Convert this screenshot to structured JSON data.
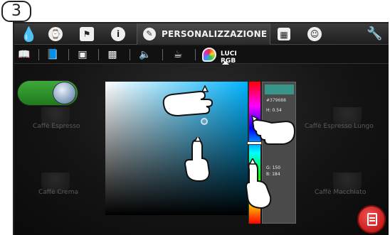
{
  "step": {
    "number": "3"
  },
  "topbar": {
    "active_tab": "PERSONALIZZAZIONE",
    "icons": [
      "drop-icon",
      "clock-icon",
      "flag-icon",
      "info-icon",
      "pen-icon",
      "calendar-icon",
      "person-icon",
      "wrench-icon"
    ]
  },
  "subbar": {
    "active_tab": "LUCI RGB",
    "icons": [
      "book-icon",
      "book-open-icon",
      "image-icon",
      "photo-icon",
      "speaker-icon",
      "cup-icon",
      "palette-icon"
    ]
  },
  "toggle": {
    "state": "on"
  },
  "background_items": {
    "top_left": "Caffè Espresso",
    "top_right": "Caffè Espresso Lungo",
    "bottom_left": "Caffè Crema",
    "bottom_right": "Caffè Macchiato"
  },
  "color_picker": {
    "hex": "#379688",
    "h_label": "H:",
    "h_value": "0.54",
    "g_label": "G:",
    "g_value": "150",
    "b_label": "B:",
    "b_value": "184"
  },
  "colors": {
    "toggle_on": "#3ea83a",
    "menu_button": "#d62828",
    "accent_drop": "#2aa7e8"
  }
}
